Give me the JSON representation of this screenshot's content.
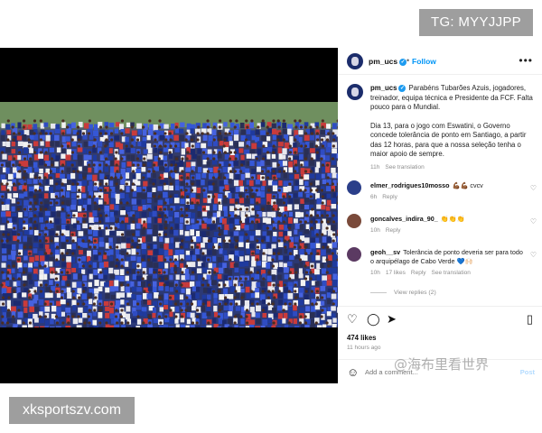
{
  "overlays": {
    "telegram_tag": "TG: MYYJJPP",
    "site_tag": "xksportszv.com",
    "watermark": "@海布里看世界"
  },
  "post": {
    "username": "pm_ucs",
    "follow_label": "Follow",
    "caption_line1": "Parabéns Tubarões Azuis, jogadores, treinador, equipa técnica e Presidente da FCF. Falta pouco para o Mundial.",
    "caption_line2": "Dia 13, para o jogo com Eswatini, o Governo concede tolerância de ponto em Santiago, a partir das 12 horas, para que a nossa seleção tenha o maior apoio de sempre.",
    "caption_time": "11h",
    "see_translation": "See translation",
    "likes": "474 likes",
    "time_ago": "11 hours ago",
    "add_comment_placeholder": "Add a comment...",
    "post_label": "Post"
  },
  "comments": [
    {
      "username": "elmer_rodrigues10mosso",
      "text": "💪🏾💪🏾 cvcv",
      "time": "6h",
      "reply": "Reply",
      "likes": "",
      "see_translation": ""
    },
    {
      "username": "goncalves_indira_90_",
      "text": "👏👏👏",
      "time": "10h",
      "reply": "Reply",
      "likes": "",
      "see_translation": ""
    },
    {
      "username": "geoh__sv",
      "text": "Tolerância de ponto deveria ser para todo o arquipélago de Cabo Verde 💙🙌🏻",
      "time": "10h",
      "reply": "Reply",
      "likes": "17 likes",
      "see_translation": "See translation"
    }
  ],
  "view_replies": "View replies (2)",
  "icons": {
    "more": "more-options-icon",
    "heart": "heart-icon",
    "comment": "comment-icon",
    "share": "share-icon",
    "save": "bookmark-icon",
    "emoji": "emoji-icon"
  },
  "colors": {
    "accent": "#0095f6",
    "verified": "#1d9bf0",
    "badge_bg": "#9e9e9e"
  }
}
